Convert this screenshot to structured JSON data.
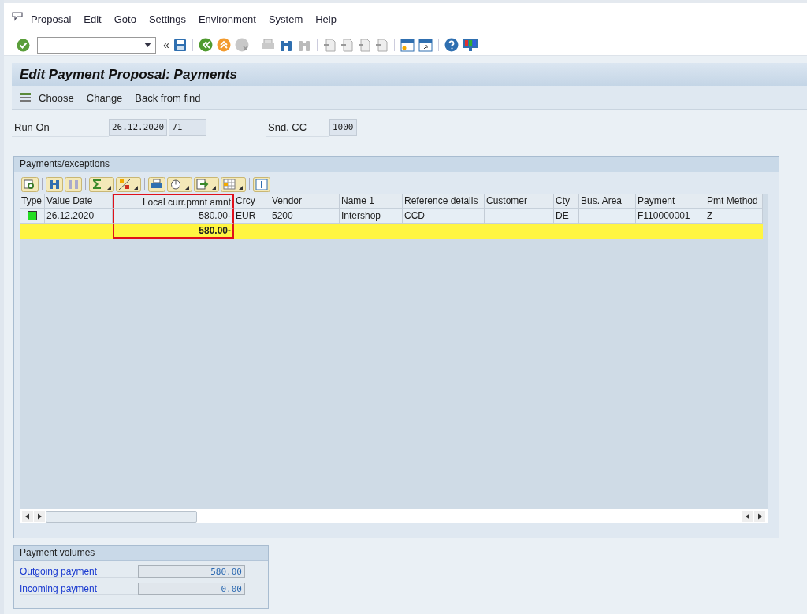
{
  "menu": [
    "Proposal",
    "Edit",
    "Goto",
    "Settings",
    "Environment",
    "System",
    "Help"
  ],
  "nav_symbol": "«",
  "title": "Edit Payment Proposal: Payments",
  "app_toolbar": [
    "Choose",
    "Change",
    "Back from find"
  ],
  "header_fields": [
    {
      "label": "Run On",
      "values": [
        "26.12.2020",
        "71"
      ]
    },
    {
      "label": "Snd. CC",
      "values": [
        "1000"
      ]
    }
  ],
  "payments_group": {
    "title": "Payments/exceptions",
    "table": {
      "columns": [
        {
          "label": "Type",
          "highlighted": false
        },
        {
          "label": "Value Date",
          "highlighted": false
        },
        {
          "label": "Local curr.pmnt amnt",
          "highlighted": true
        },
        {
          "label": "Crcy",
          "highlighted": false
        },
        {
          "label": "Vendor",
          "highlighted": false
        },
        {
          "label": "Name 1",
          "highlighted": false
        },
        {
          "label": "Reference details",
          "highlighted": false
        },
        {
          "label": "Customer",
          "highlighted": false
        },
        {
          "label": "Cty",
          "highlighted": false
        },
        {
          "label": "Bus. Area",
          "highlighted": false
        },
        {
          "label": "Payment",
          "highlighted": false
        },
        {
          "label": "Pmt Method",
          "highlighted": false
        }
      ],
      "rows": [
        {
          "kind": "item",
          "color": "#22dd22",
          "cells": [
            "",
            "26.12.2020",
            "580.00-",
            "EUR",
            "5200",
            "Intershop",
            "CCD",
            "",
            "DE",
            "",
            "F110000001",
            "Z"
          ]
        },
        {
          "kind": "total",
          "cells": [
            "",
            "",
            "580.00-",
            "",
            "",
            "",
            "",
            "",
            "",
            "",
            "",
            ""
          ]
        }
      ]
    }
  },
  "payment_volumes": {
    "title": "Payment volumes",
    "rows": [
      {
        "label": "Outgoing payment",
        "value": "580.00"
      },
      {
        "label": "Incoming payment",
        "value": "0.00"
      }
    ]
  }
}
